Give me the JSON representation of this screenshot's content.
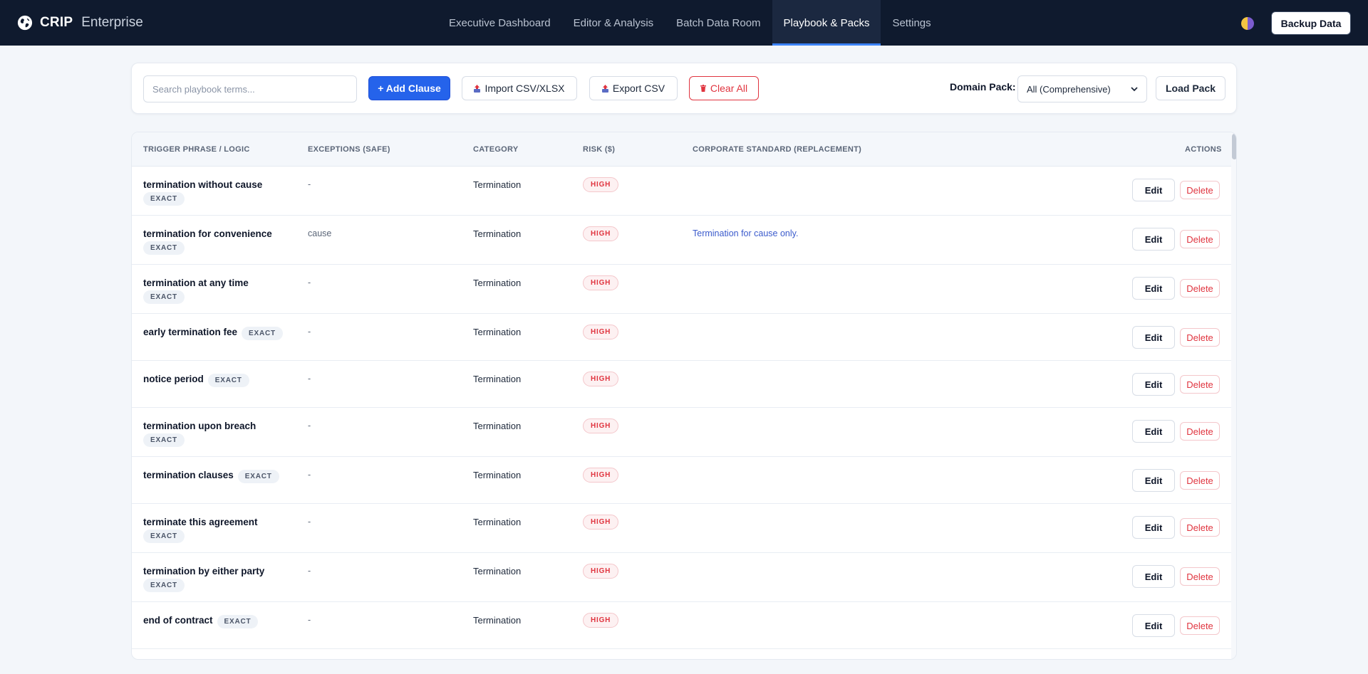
{
  "brand": {
    "name": "CRIP",
    "suffix": "Enterprise",
    "logo_icon": "globe-icon"
  },
  "nav": {
    "items": [
      {
        "label": "Executive Dashboard",
        "active": false
      },
      {
        "label": "Editor & Analysis",
        "active": false
      },
      {
        "label": "Batch Data Room",
        "active": false
      },
      {
        "label": "Playbook & Packs",
        "active": true
      },
      {
        "label": "Settings",
        "active": false
      }
    ],
    "theme_toggle_icon": "theme-toggle-icon",
    "backup_label": "Backup Data"
  },
  "toolbar": {
    "search_placeholder": "Search playbook terms...",
    "add_label": "+ Add Clause",
    "import_label": "Import CSV/XLSX",
    "export_label": "Export CSV",
    "clear_label": "Clear All",
    "domain_label": "Domain Pack:",
    "domain_selected": "All (Comprehensive)",
    "load_label": "Load Pack"
  },
  "table": {
    "headers": {
      "trigger": "TRIGGER PHRASE / LOGIC",
      "exceptions": "EXCEPTIONS (SAFE)",
      "category": "CATEGORY",
      "risk": "RISK ($)",
      "standard": "CORPORATE STANDARD (REPLACEMENT)",
      "actions": "ACTIONS"
    },
    "edit_label": "Edit",
    "delete_label": "Delete",
    "rows": [
      {
        "trigger": "termination without cause",
        "match": "EXACT",
        "exceptions": "-",
        "category": "Termination",
        "risk": "HIGH",
        "standard": ""
      },
      {
        "trigger": "termination for convenience",
        "match": "EXACT",
        "exceptions": "cause",
        "category": "Termination",
        "risk": "HIGH",
        "standard": "Termination for cause only."
      },
      {
        "trigger": "termination at any time",
        "match": "EXACT",
        "exceptions": "-",
        "category": "Termination",
        "risk": "HIGH",
        "standard": ""
      },
      {
        "trigger": "early termination fee",
        "match": "EXACT",
        "exceptions": "-",
        "category": "Termination",
        "risk": "HIGH",
        "standard": ""
      },
      {
        "trigger": "notice period",
        "match": "EXACT",
        "exceptions": "-",
        "category": "Termination",
        "risk": "HIGH",
        "standard": ""
      },
      {
        "trigger": "termination upon breach",
        "match": "EXACT",
        "exceptions": "-",
        "category": "Termination",
        "risk": "HIGH",
        "standard": ""
      },
      {
        "trigger": "termination clauses",
        "match": "EXACT",
        "exceptions": "-",
        "category": "Termination",
        "risk": "HIGH",
        "standard": ""
      },
      {
        "trigger": "terminate this agreement",
        "match": "EXACT",
        "exceptions": "-",
        "category": "Termination",
        "risk": "HIGH",
        "standard": ""
      },
      {
        "trigger": "termination by either party",
        "match": "EXACT",
        "exceptions": "-",
        "category": "Termination",
        "risk": "HIGH",
        "standard": ""
      },
      {
        "trigger": "end of contract",
        "match": "EXACT",
        "exceptions": "-",
        "category": "Termination",
        "risk": "HIGH",
        "standard": ""
      }
    ]
  },
  "colors": {
    "nav_bg": "#0f1a2e",
    "primary": "#2563eb",
    "danger": "#e0343f",
    "link": "#3b5bcc",
    "page_bg": "#f3f6fa"
  }
}
